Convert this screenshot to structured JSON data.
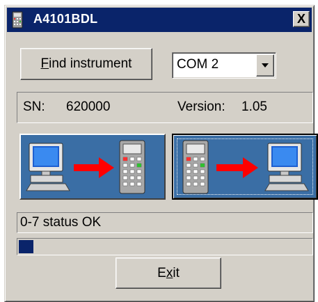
{
  "window": {
    "title": "A4101BDL",
    "close_label": "X"
  },
  "connection": {
    "find_button_label_prefix": "",
    "find_button_label_accel": "F",
    "find_button_label_rest": "ind instrument",
    "port": {
      "selected": "COM 2"
    }
  },
  "instrument_info": {
    "sn_label": "SN:",
    "sn_value": "620000",
    "version_label": "Version:",
    "version_value": "1.05"
  },
  "transfer": {
    "upload_icon": "pc-to-instrument-icon",
    "download_icon": "instrument-to-pc-icon"
  },
  "status": {
    "text": "0-7 status OK",
    "progress": 0.05
  },
  "exit_button": {
    "label_prefix": "E",
    "label_accel": "x",
    "label_rest": "it"
  },
  "colors": {
    "titlebar": "#0a246a",
    "face": "#d4d0c8",
    "transfer_bg": "#3a6ea5",
    "arrow": "#ff0000",
    "progress": "#0a246a"
  }
}
